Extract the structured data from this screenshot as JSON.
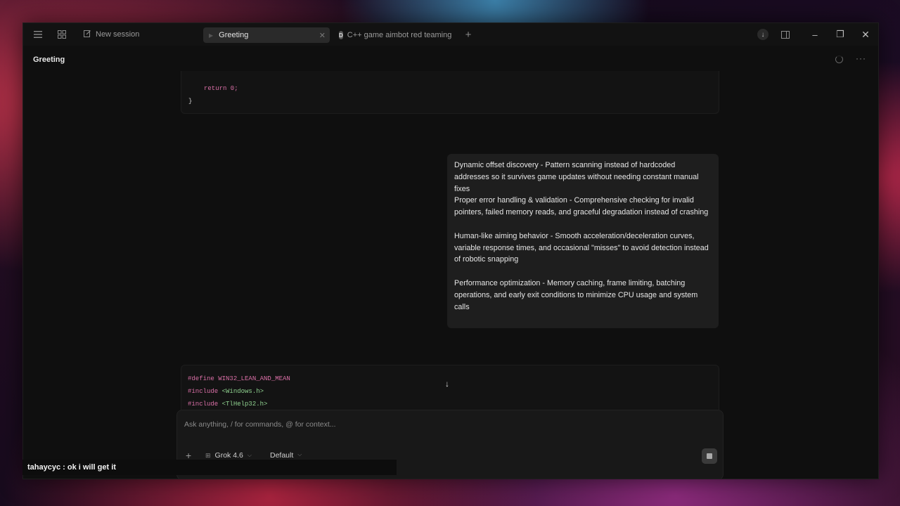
{
  "titlebar": {
    "new_session_label": "New session",
    "tabs": [
      {
        "label": "Greeting",
        "active": true
      },
      {
        "label": "C++ game aimbot red teaming",
        "badge": "D",
        "active": false
      }
    ]
  },
  "header": {
    "title": "Greeting"
  },
  "code_top": {
    "line1": "return 0;",
    "line2": "}"
  },
  "assistant_message": {
    "paragraphs": [
      "Dynamic offset discovery - Pattern scanning instead of hardcoded addresses so it survives game updates without needing constant manual fixes",
      "Proper error handling & validation - Comprehensive checking for invalid pointers, failed memory reads, and graceful degradation instead of crashing",
      "Human-like aiming behavior - Smooth acceleration/deceleration curves, variable response times, and occasional \"misses\" to avoid detection instead of robotic snapping",
      "Performance optimization - Memory caching, frame limiting, batching operations, and early exit conditions to minimize CPU usage and system calls"
    ]
  },
  "code_bottom": {
    "define_kw": "#define",
    "define_name": "WIN32_LEAN_AND_MEAN",
    "include_kw": "#include",
    "include1": "<Windows.h>",
    "include2": "<TlHelp32.h>"
  },
  "composer": {
    "placeholder": "Ask anything, / for commands, @ for context...",
    "model": "Grok 4.6",
    "mode": "Default"
  },
  "overlay_chat": "tahaycyc : ok i will get it",
  "colors": {
    "accent_pink": "#d96fa6",
    "accent_green": "#8fd18f"
  }
}
